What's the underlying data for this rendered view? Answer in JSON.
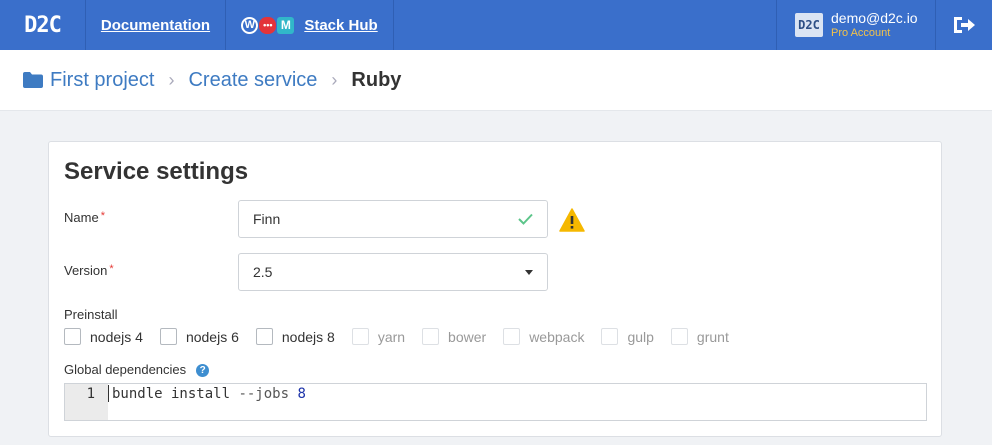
{
  "app": {
    "logo": "D2C",
    "nav_documentation": "Documentation",
    "nav_stackhub": "Stack Hub",
    "hub_icons": [
      "wordpress-icon",
      "chat-icon",
      "m-icon"
    ],
    "account_avatar": "D2C",
    "account_email": "demo@d2c.io",
    "account_plan": "Pro Account"
  },
  "breadcrumb": {
    "items": [
      "First project",
      "Create service",
      "Ruby"
    ]
  },
  "card": {
    "title": "Service settings",
    "name_label": "Name",
    "name_value": "Finn",
    "version_label": "Version",
    "version_value": "2.5",
    "required_mark": "*",
    "preinstall_label": "Preinstall",
    "preinstall": [
      {
        "label": "nodejs 4",
        "enabled": true,
        "checked": false
      },
      {
        "label": "nodejs 6",
        "enabled": true,
        "checked": false
      },
      {
        "label": "nodejs 8",
        "enabled": true,
        "checked": false
      },
      {
        "label": "yarn",
        "enabled": false,
        "checked": false
      },
      {
        "label": "bower",
        "enabled": false,
        "checked": false
      },
      {
        "label": "webpack",
        "enabled": false,
        "checked": false
      },
      {
        "label": "gulp",
        "enabled": false,
        "checked": false
      },
      {
        "label": "grunt",
        "enabled": false,
        "checked": false
      }
    ],
    "global_deps_label": "Global dependencies",
    "help_glyph": "?",
    "editor": {
      "line_number": "1",
      "tok_cmd": "bundle install",
      "tok_flag": "--jobs",
      "tok_num": "8"
    }
  },
  "colors": {
    "topbar": "#3a6fcb",
    "link": "#3e7bc2",
    "plan": "#f3c24a",
    "valid": "#5cc58a",
    "warning": "#f5b800",
    "required": "#e53935"
  }
}
